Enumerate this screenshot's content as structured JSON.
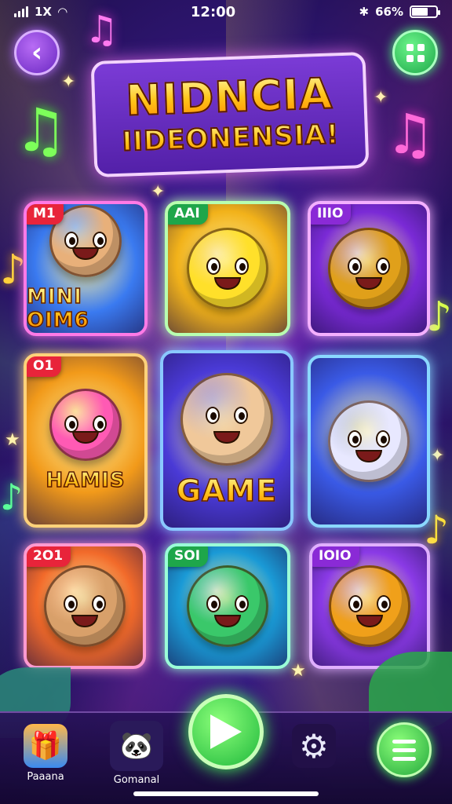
{
  "status_bar": {
    "network": "1X",
    "time": "12:00",
    "battery": "66%",
    "battery_level": 0.66
  },
  "header": {
    "title_line1": "NIDNCIA",
    "title_line2": "IIDEONENSIA!"
  },
  "cards": [
    {
      "badge": "M1",
      "caption": "MINI OIM6",
      "badge_color": "#e8243a",
      "border": "#ff7ae6",
      "bg": "#3a7af0",
      "icon_color": "#e8b07a"
    },
    {
      "badge": "AAI",
      "caption": "",
      "badge_color": "#1ea64a",
      "border": "#b8ffb0",
      "bg": "#f2b21a",
      "icon_color": "#ffe02a"
    },
    {
      "badge": "IIIO",
      "caption": "",
      "badge_color": "#8a2ad6",
      "border": "#f4b0ff",
      "bg": "#7a2ad6",
      "icon_color": "#e0a01a"
    },
    {
      "badge": "O1",
      "caption": "HAMIS",
      "badge_color": "#e8243a",
      "border": "#ffd27a",
      "bg": "#f29a1a",
      "icon_color": "#ff5ab4"
    },
    {
      "badge": "",
      "caption": "GAME",
      "badge_color": "#3a7af0",
      "border": "#8ac8ff",
      "bg": "#4a3ad6",
      "icon_color": "#f0c89a"
    },
    {
      "badge": "",
      "caption": "",
      "badge_color": "#3a7af0",
      "border": "#8ad8ff",
      "bg": "#3a5ae6",
      "icon_color": "#e8e8ff"
    },
    {
      "badge": "2O1",
      "caption": "",
      "badge_color": "#e8243a",
      "border": "#ff9ad0",
      "bg": "#f26a2a",
      "icon_color": "#d8a06a"
    },
    {
      "badge": "SOI",
      "caption": "",
      "badge_color": "#1ea64a",
      "border": "#9affd8",
      "bg": "#1a9ad6",
      "icon_color": "#3ac86a"
    },
    {
      "badge": "IOIO",
      "caption": "",
      "badge_color": "#8a2ad6",
      "border": "#e0b0ff",
      "bg": "#8a3ae6",
      "icon_color": "#f0a01a"
    }
  ],
  "nav": {
    "item1_label": "Paaana",
    "item2_label": "Gomanal"
  },
  "icons": {
    "back": "chevron-left-icon",
    "grid": "grid-icon",
    "play": "play-icon",
    "settings": "gear-icon",
    "menu": "hamburger-icon"
  }
}
